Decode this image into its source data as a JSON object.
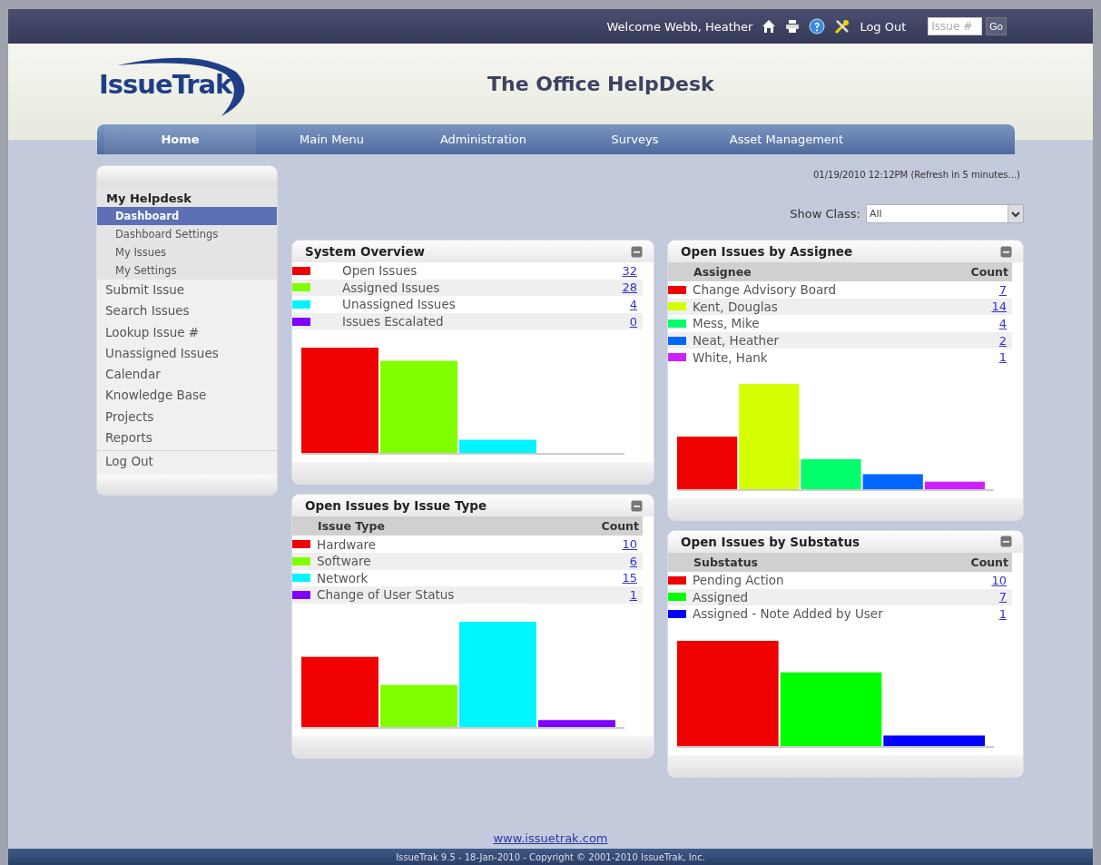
{
  "top_bar": {
    "welcome": "Welcome Webb, Heather",
    "logout": "Log Out",
    "issue_field": {
      "placeholder": "Issue #"
    },
    "go_button": "Go"
  },
  "header": {
    "logo": "IssueTrak",
    "title": "The Office HelpDesk"
  },
  "nav": [
    {
      "label": "Home",
      "selected": true
    },
    {
      "label": "Main Menu",
      "selected": false
    },
    {
      "label": "Administration",
      "selected": false
    },
    {
      "label": "Surveys",
      "selected": false
    },
    {
      "label": "Asset Management",
      "selected": false
    }
  ],
  "sidebar": {
    "section": "My Helpdesk",
    "sub_items": [
      {
        "label": "Dashboard",
        "selected": true
      },
      {
        "label": "Dashboard Settings",
        "selected": false
      },
      {
        "label": "My Issues",
        "selected": false
      },
      {
        "label": "My Settings",
        "selected": false
      }
    ],
    "items": [
      "Submit Issue",
      "Search Issues",
      "Lookup Issue #",
      "Unassigned Issues",
      "Calendar",
      "Knowledge Base",
      "Projects",
      "Reports"
    ],
    "logout": "Log Out"
  },
  "timestamp": "01/19/2010 12:12PM (Refresh in 5 minutes...)",
  "show_class": {
    "label": "Show Class:",
    "value": "All"
  },
  "columns": [
    [
      {
        "title": "System Overview",
        "rows": [
          {
            "label": "Open Issues",
            "count": "32",
            "color": "#f00000"
          },
          {
            "label": "Assigned Issues",
            "count": "28",
            "color": "#80ff00"
          },
          {
            "label": "Unassigned Issues",
            "count": "4",
            "color": "#00f5ff"
          },
          {
            "label": "Issues Escalated",
            "count": "0",
            "color": "#8000ff"
          }
        ]
      },
      {
        "title": "Open Issues by Issue Type",
        "columns": [
          "Issue Type",
          "Count"
        ],
        "rows": [
          {
            "label": "Hardware",
            "count": "10",
            "color": "#f00000"
          },
          {
            "label": "Software",
            "count": "6",
            "color": "#80ff00"
          },
          {
            "label": "Network",
            "count": "15",
            "color": "#00f5ff"
          },
          {
            "label": "Change of User Status",
            "count": "1",
            "color": "#8000ff"
          }
        ]
      }
    ],
    [
      {
        "title": "Open Issues by Assignee",
        "columns": [
          "Assignee",
          "Count"
        ],
        "rows": [
          {
            "label": "Change Advisory Board",
            "count": "7",
            "color": "#f00000"
          },
          {
            "label": "Kent, Douglas",
            "count": "14",
            "color": "#d4ff00"
          },
          {
            "label": "Mess, Mike",
            "count": "4",
            "color": "#00ff6a"
          },
          {
            "label": "Neat, Heather",
            "count": "2",
            "color": "#0066ff"
          },
          {
            "label": "White, Hank",
            "count": "1",
            "color": "#cc22ff"
          }
        ]
      },
      {
        "title": "Open Issues by Substatus",
        "columns": [
          "Substatus",
          "Count"
        ],
        "rows": [
          {
            "label": "Pending Action",
            "count": "10",
            "color": "#f00000"
          },
          {
            "label": "Assigned",
            "count": "7",
            "color": "#00ff00"
          },
          {
            "label": "Assigned - Note Added by User",
            "count": "1",
            "color": "#0000ff"
          }
        ]
      }
    ]
  ],
  "footer_link": "www.issuetrak.com",
  "footer": "IssueTrak 9.5 - 18-Jan-2010 - Copyright © 2001-2010 IssueTrak, Inc."
}
